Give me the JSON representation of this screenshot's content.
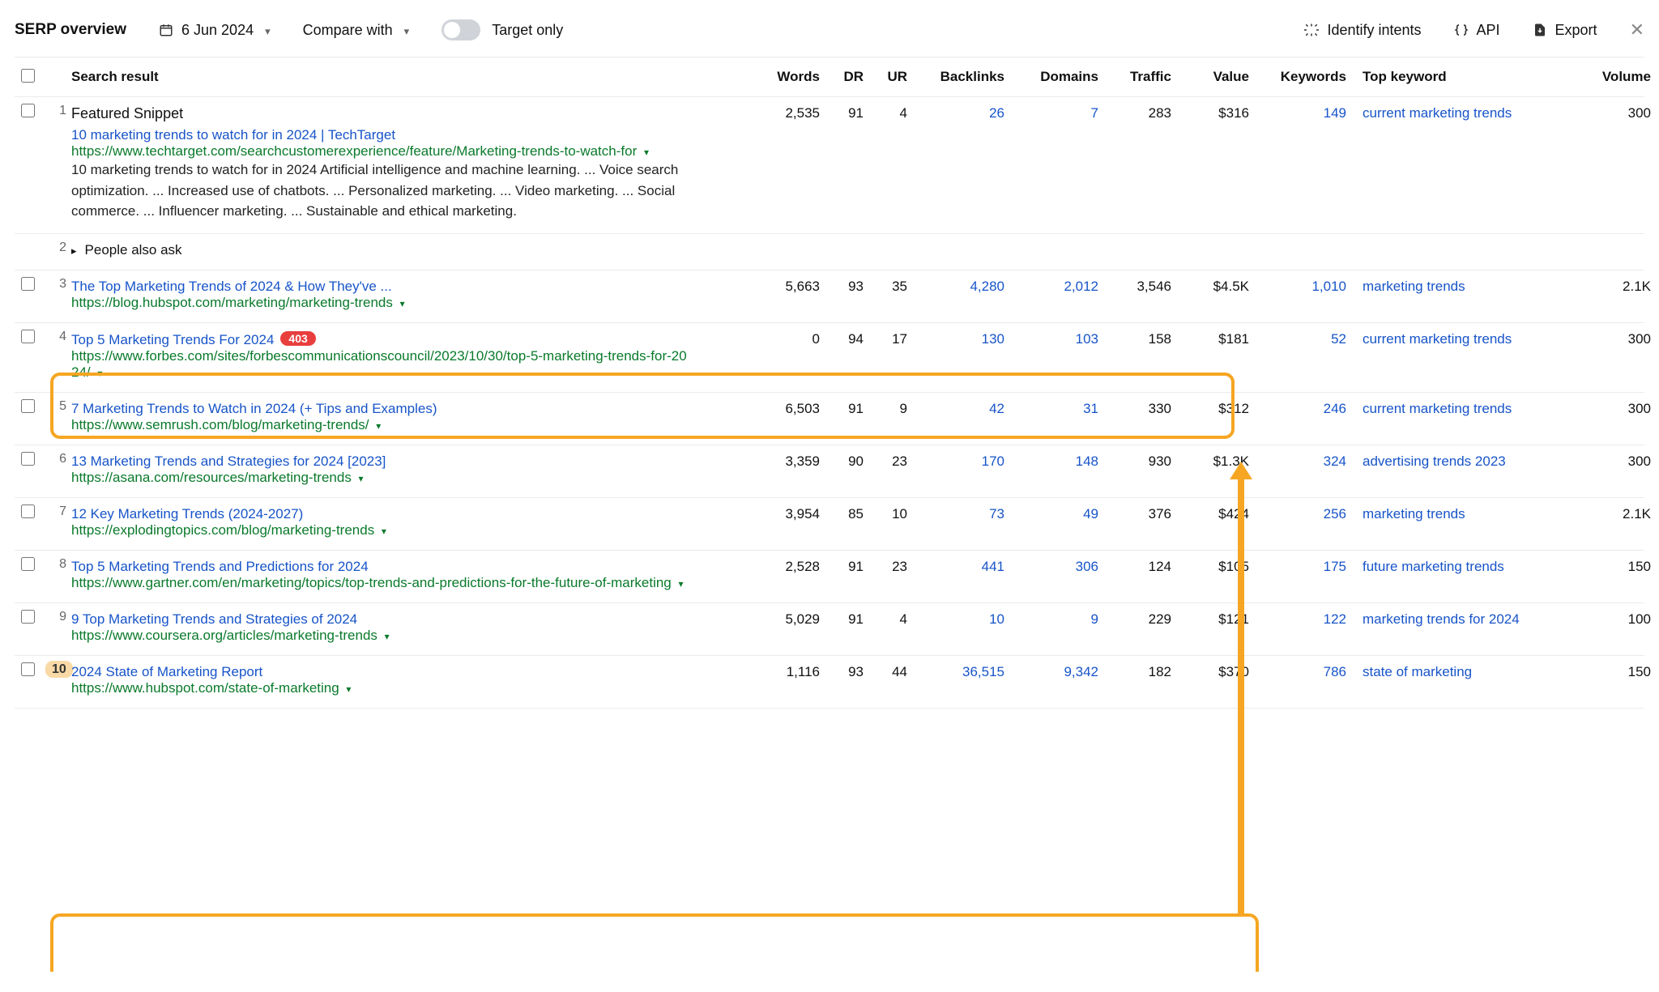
{
  "toolbar": {
    "title": "SERP overview",
    "date": "6 Jun 2024",
    "compare": "Compare with",
    "target_only": "Target only",
    "identify": "Identify intents",
    "api": "API",
    "export": "Export"
  },
  "columns": {
    "search_result": "Search result",
    "words": "Words",
    "dr": "DR",
    "ur": "UR",
    "backlinks": "Backlinks",
    "domains": "Domains",
    "traffic": "Traffic",
    "value": "Value",
    "keywords": "Keywords",
    "top_keyword": "Top keyword",
    "volume": "Volume"
  },
  "featured_label": "Featured Snippet",
  "paa_label": "People also ask",
  "rows": [
    {
      "pos": "1",
      "title": "10 marketing trends to watch for in 2024 | TechTarget",
      "url": "https://www.techtarget.com/searchcustomerexperience/feature/Marketing-trends-to-watch-for",
      "snippet": "10 marketing trends to watch for in 2024 Artificial intelligence and machine learning. ... Voice search optimization. ... Increased use of chatbots. ... Personalized marketing. ... Video marketing. ... Social commerce. ... Influencer marketing. ... Sustainable and ethical marketing.",
      "words": "2,535",
      "dr": "91",
      "ur": "4",
      "backlinks": "26",
      "domains": "7",
      "traffic": "283",
      "value": "$316",
      "keywords": "149",
      "top_keyword": "current marketing trends",
      "volume": "300"
    },
    {
      "pos": "2",
      "paa": true
    },
    {
      "pos": "3",
      "title": "The Top Marketing Trends of 2024 & How They've ...",
      "url": "https://blog.hubspot.com/marketing/marketing-trends",
      "words": "5,663",
      "dr": "93",
      "ur": "35",
      "backlinks": "4,280",
      "domains": "2,012",
      "traffic": "3,546",
      "value": "$4.5K",
      "keywords": "1,010",
      "top_keyword": "marketing trends",
      "volume": "2.1K"
    },
    {
      "pos": "4",
      "title": "Top 5 Marketing Trends For 2024",
      "badge": "403",
      "url": "https://www.forbes.com/sites/forbescommunicationscouncil/2023/10/30/top-5-marketing-trends-for-2024/",
      "words": "0",
      "dr": "94",
      "ur": "17",
      "backlinks": "130",
      "domains": "103",
      "traffic": "158",
      "value": "$181",
      "keywords": "52",
      "top_keyword": "current marketing trends",
      "volume": "300"
    },
    {
      "pos": "5",
      "title": "7 Marketing Trends to Watch in 2024 (+ Tips and Examples)",
      "url": "https://www.semrush.com/blog/marketing-trends/",
      "words": "6,503",
      "dr": "91",
      "ur": "9",
      "backlinks": "42",
      "domains": "31",
      "traffic": "330",
      "value": "$312",
      "keywords": "246",
      "top_keyword": "current marketing trends",
      "volume": "300"
    },
    {
      "pos": "6",
      "title": "13 Marketing Trends and Strategies for 2024 [2023]",
      "url": "https://asana.com/resources/marketing-trends",
      "words": "3,359",
      "dr": "90",
      "ur": "23",
      "backlinks": "170",
      "domains": "148",
      "traffic": "930",
      "value": "$1.3K",
      "keywords": "324",
      "top_keyword": "advertising trends 2023",
      "volume": "300"
    },
    {
      "pos": "7",
      "title": "12 Key Marketing Trends (2024-2027)",
      "url": "https://explodingtopics.com/blog/marketing-trends",
      "words": "3,954",
      "dr": "85",
      "ur": "10",
      "backlinks": "73",
      "domains": "49",
      "traffic": "376",
      "value": "$424",
      "keywords": "256",
      "top_keyword": "marketing trends",
      "volume": "2.1K"
    },
    {
      "pos": "8",
      "title": "Top 5 Marketing Trends and Predictions for 2024",
      "url": "https://www.gartner.com/en/marketing/topics/top-trends-and-predictions-for-the-future-of-marketing",
      "words": "2,528",
      "dr": "91",
      "ur": "23",
      "backlinks": "441",
      "domains": "306",
      "traffic": "124",
      "value": "$105",
      "keywords": "175",
      "top_keyword": "future marketing trends",
      "volume": "150"
    },
    {
      "pos": "9",
      "title": "9 Top Marketing Trends and Strategies of 2024",
      "url": "https://www.coursera.org/articles/marketing-trends",
      "words": "5,029",
      "dr": "91",
      "ur": "4",
      "backlinks": "10",
      "domains": "9",
      "traffic": "229",
      "value": "$121",
      "keywords": "122",
      "top_keyword": "marketing trends for 2024",
      "volume": "100"
    },
    {
      "pos": "10",
      "title": "2024 State of Marketing Report",
      "url": "https://www.hubspot.com/state-of-marketing",
      "words": "1,116",
      "dr": "93",
      "ur": "44",
      "backlinks": "36,515",
      "domains": "9,342",
      "traffic": "182",
      "value": "$370",
      "keywords": "786",
      "top_keyword": "state of marketing",
      "volume": "150"
    }
  ]
}
